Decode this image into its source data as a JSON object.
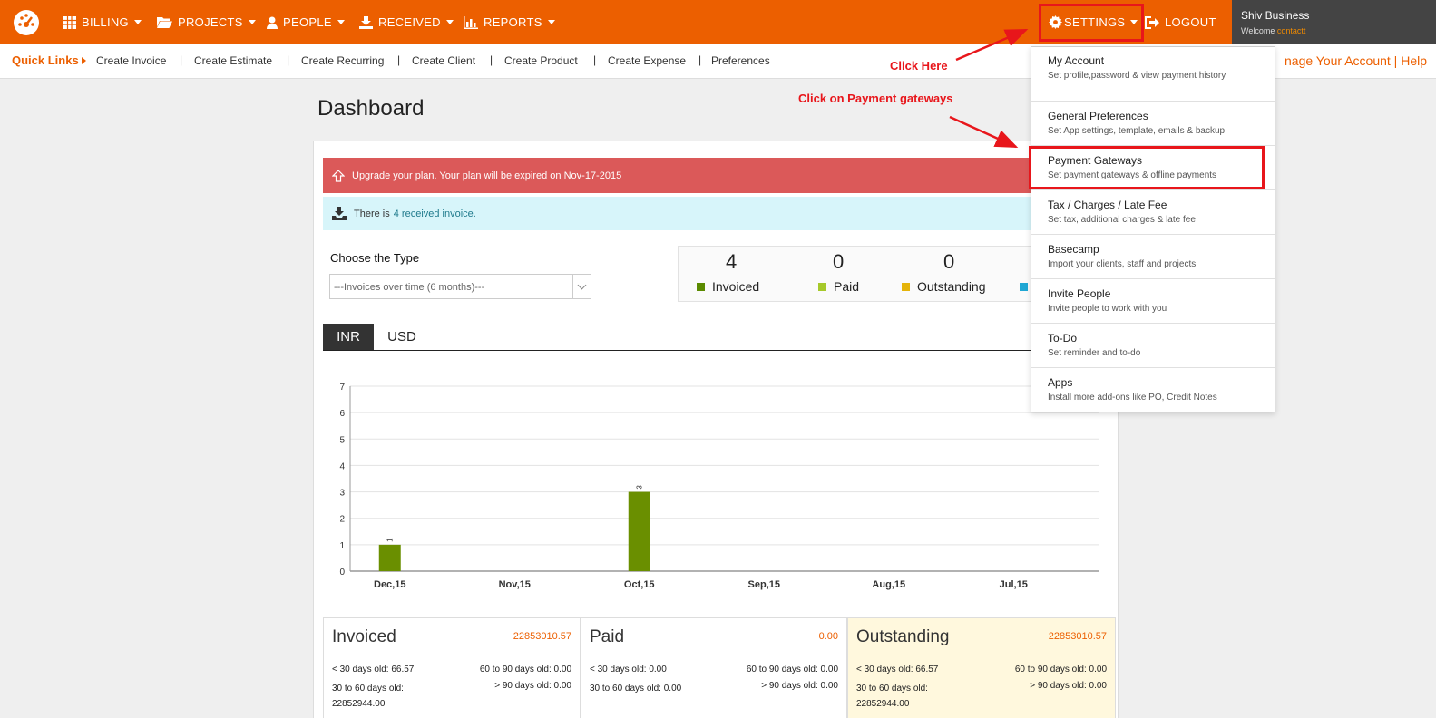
{
  "nav": {
    "billing": "BILLING",
    "projects": "PROJECTS",
    "people": "PEOPLE",
    "received": "RECEIVED",
    "reports": "REPORTS",
    "settings": "SETTINGS",
    "logout": "LOGOUT"
  },
  "user": {
    "name": "Shiv Business",
    "welcome": "Welcome",
    "username": "contactt"
  },
  "quick_links": {
    "label": "Quick Links",
    "items": [
      "Create Invoice",
      "Create Estimate",
      "Create Recurring",
      "Create Client",
      "Create Product",
      "Create Expense",
      "Preferences"
    ],
    "separator": "|",
    "manage": "nage Your Account | Help"
  },
  "page_title": "Dashboard",
  "alerts": {
    "upgrade": "Upgrade your plan. Your plan will be expired on Nov-17-2015",
    "received_prefix": "There is",
    "received_link": "4 received invoice."
  },
  "type_select": {
    "label": "Choose the Type",
    "value": "---Invoices over time (6 months)---"
  },
  "stats": [
    {
      "value": "4",
      "label": "Invoiced",
      "color": "#5a8a00"
    },
    {
      "value": "0",
      "label": "Paid",
      "color": "#a6c92a"
    },
    {
      "value": "0",
      "label": "Outstanding",
      "color": "#e5b40a"
    },
    {
      "value": "",
      "label": "",
      "color": "#1fa7d4"
    }
  ],
  "currency_tabs": [
    "INR",
    "USD"
  ],
  "chart_data": {
    "type": "bar",
    "categories": [
      "Dec,15",
      "Nov,15",
      "Oct,15",
      "Sep,15",
      "Aug,15",
      "Jul,15"
    ],
    "values": [
      1,
      0,
      3,
      0,
      0,
      0
    ],
    "data_labels": [
      "1",
      "",
      "3",
      "",
      "",
      ""
    ],
    "ylim": [
      0,
      7
    ],
    "yticks": [
      "0",
      "1",
      "2",
      "3",
      "4",
      "5",
      "6",
      "7"
    ],
    "bar_color": "#6a8f00",
    "grid": true
  },
  "cards": [
    {
      "title": "Invoiced",
      "total": "22853010.57",
      "lt30": "< 30 days old: 66.57",
      "d60_90": "60 to 90 days old: 0.00",
      "d30_60": "30 to 60 days old: 22852944.00",
      "gt90": "> 90 days old: 0.00"
    },
    {
      "title": "Paid",
      "total": "0.00",
      "lt30": "< 30 days old: 0.00",
      "d60_90": "60 to 90 days old: 0.00",
      "d30_60": "30 to 60 days old: 0.00",
      "gt90": "> 90 days old: 0.00"
    },
    {
      "title": "Outstanding",
      "total": "22853010.57",
      "lt30": "< 30 days old: 66.57",
      "d60_90": "60 to 90 days old: 0.00",
      "d30_60": "30 to 60 days old: 22852944.00",
      "gt90": "> 90 days old: 0.00"
    }
  ],
  "settings_menu": [
    {
      "title": "My Account",
      "desc": "Set profile,password & view payment history"
    },
    {
      "title": "General Preferences",
      "desc": "Set App settings, template, emails & backup"
    },
    {
      "title": "Payment Gateways",
      "desc": "Set payment gateways & offline payments"
    },
    {
      "title": "Tax / Charges / Late Fee",
      "desc": "Set tax, additional charges & late fee"
    },
    {
      "title": "Basecamp",
      "desc": "Import your clients, staff and projects"
    },
    {
      "title": "Invite People",
      "desc": "Invite people to work with you"
    },
    {
      "title": "To-Do",
      "desc": "Set reminder and to-do"
    },
    {
      "title": "Apps",
      "desc": "Install more add-ons like PO, Credit Notes"
    }
  ],
  "annotations": {
    "click_here": "Click Here",
    "click_payment": "Click on Payment gateways"
  },
  "colors": {
    "brand": "#ec5f00",
    "highlight": "#e8161b"
  }
}
